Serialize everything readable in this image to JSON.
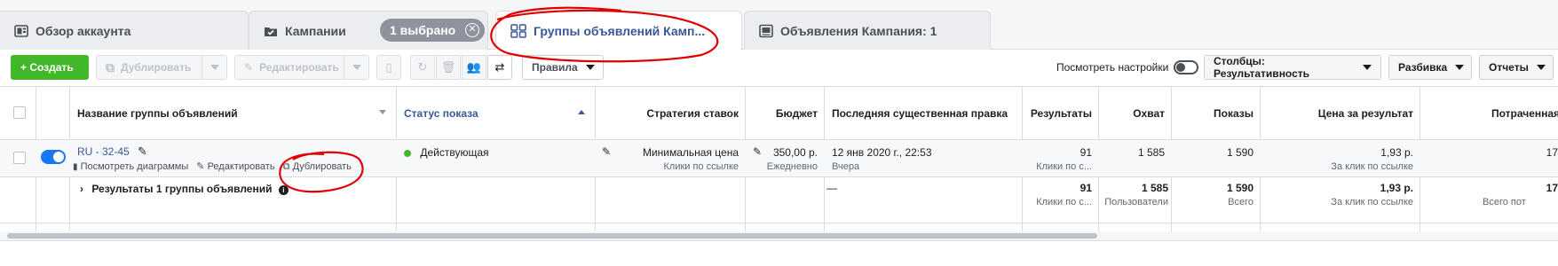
{
  "tabs": [
    {
      "label": "Обзор аккаунта",
      "icon": "dashboard-icon"
    },
    {
      "label": "Кампании",
      "icon": "folder-check-icon"
    },
    {
      "label": "Группы объявлений Камп...",
      "icon": "grid-icon"
    },
    {
      "label": "Объявления Кампания: 1",
      "icon": "ad-icon"
    }
  ],
  "selection_pill": {
    "label": "1 выбрано",
    "icon": "close-circle-icon"
  },
  "toolbar": {
    "create": "+ Создать",
    "duplicate": "Дублировать",
    "edit": "Редактировать",
    "rules": "Правила",
    "view_settings": "Посмотреть настройки",
    "columns": "Столбцы: Результативность",
    "breakdown": "Разбивка",
    "reports": "Отчеты"
  },
  "table": {
    "headers": {
      "name": "Название группы объявлений",
      "status": "Статус показа",
      "bid": "Стратегия ставок",
      "budget": "Бюджет",
      "last_edit": "Последняя существенная правка",
      "results": "Результаты",
      "reach": "Охват",
      "impressions": "Показы",
      "cost": "Цена за результат",
      "spent": "Потраченная"
    },
    "row": {
      "name": "RU - 32-45",
      "action_charts": "Посмотреть диаграммы",
      "action_edit": "Редактировать",
      "action_duplicate": "Дублировать",
      "status": "Действующая",
      "bid": "Минимальная цена",
      "bid_sub": "Клики по ссылке",
      "budget": "350,00 р.",
      "budget_sub": "Ежедневно",
      "last_edit": "12 янв 2020 г., 22:53",
      "last_edit_sub": "Вчера",
      "results": "91",
      "results_sub": "Клики по с...",
      "reach": "1 585",
      "impressions": "1 590",
      "cost": "1,93 р.",
      "cost_sub": "За клик по ссылке",
      "spent": "17"
    },
    "summary": {
      "label": "Результаты 1 группы объявлений",
      "last_edit": "—",
      "results": "91",
      "results_sub": "Клики по с...",
      "reach": "1 585",
      "reach_sub": "Пользователи",
      "impressions": "1 590",
      "impressions_sub": "Всего",
      "cost": "1,93 р.",
      "cost_sub": "За клик по ссылке",
      "spent": "17",
      "spent_sub": "Всего пот"
    }
  },
  "colors": {
    "accent": "#385898",
    "green": "#42b72a",
    "annotation": "#e00000",
    "toggle": "#1877f2"
  }
}
